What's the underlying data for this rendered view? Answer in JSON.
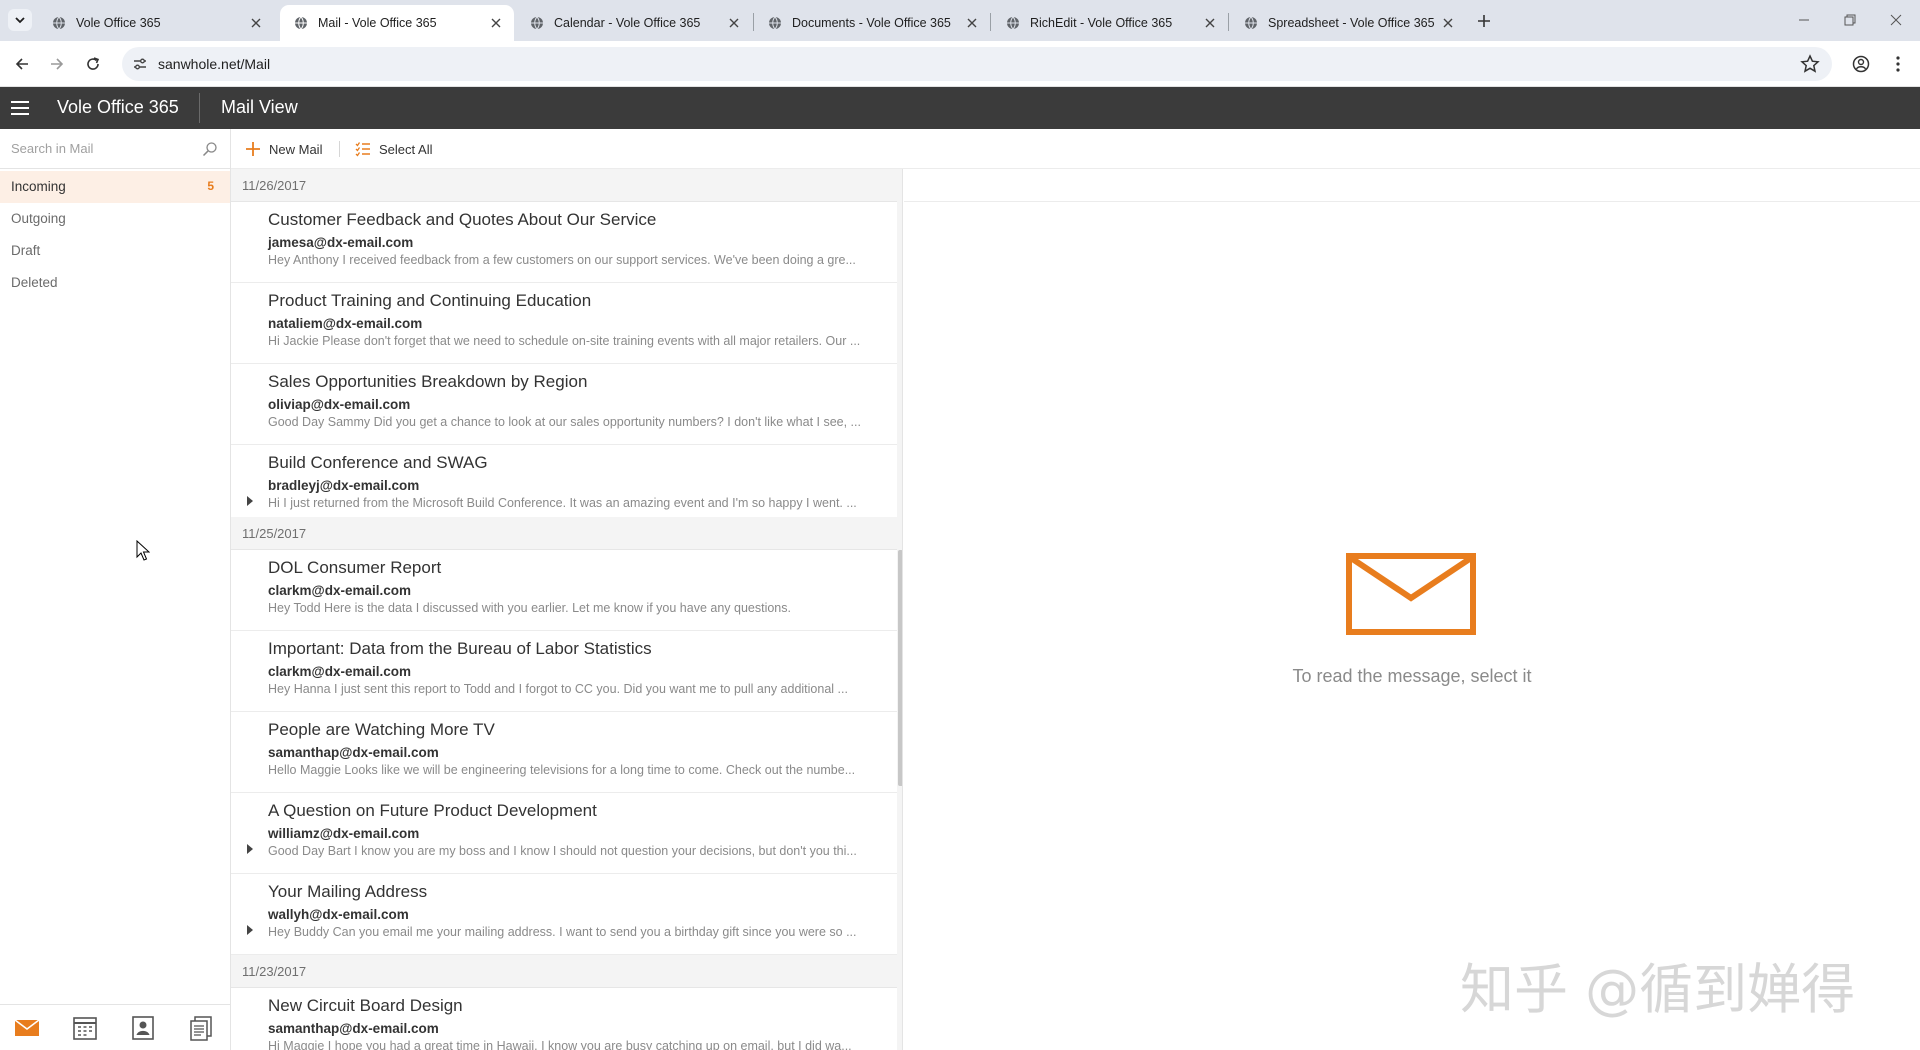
{
  "browser": {
    "tabs": [
      {
        "label": "Vole Office 365",
        "active": false
      },
      {
        "label": "Mail - Vole Office 365",
        "active": true
      },
      {
        "label": "Calendar - Vole Office 365",
        "active": false
      },
      {
        "label": "Documents - Vole Office 365",
        "active": false
      },
      {
        "label": "RichEdit - Vole Office 365",
        "active": false
      },
      {
        "label": "Spreadsheet - Vole Office 365",
        "active": false
      }
    ],
    "url": "sanwhole.net/Mail"
  },
  "app": {
    "title": "Vole Office 365",
    "view_title": "Mail View",
    "accent_color": "#e87d1e"
  },
  "sidebar": {
    "search_placeholder": "Search in Mail",
    "folders": [
      {
        "label": "Incoming",
        "count": "5",
        "active": true
      },
      {
        "label": "Outgoing",
        "count": "",
        "active": false
      },
      {
        "label": "Draft",
        "count": "",
        "active": false
      },
      {
        "label": "Deleted",
        "count": "",
        "active": false
      }
    ],
    "bottom_icons": [
      "mail-icon",
      "calendar-icon",
      "contacts-icon",
      "documents-icon"
    ]
  },
  "commands": {
    "new_mail": "New Mail",
    "select_all": "Select All"
  },
  "mail_groups": [
    {
      "date": "11/26/2017",
      "mails": [
        {
          "subject": "Customer Feedback and Quotes About Our Service",
          "from": "jamesa@dx-email.com",
          "preview": "Hey Anthony   I received feedback from a few customers on our support services. We've been doing a gre...",
          "thread": false
        },
        {
          "subject": "Product Training and Continuing Education",
          "from": "nataliem@dx-email.com",
          "preview": "Hi Jackie   Please don't forget that we need to schedule on-site training events with all major retailers. Our ...",
          "thread": false
        },
        {
          "subject": "Sales Opportunities Breakdown by Region",
          "from": "oliviap@dx-email.com",
          "preview": "Good Day Sammy   Did you get a chance to look at our sales opportunity numbers? I don't like what I see, ...",
          "thread": false
        },
        {
          "subject": "Build Conference and SWAG",
          "from": "bradleyj@dx-email.com",
          "preview": "Hi   I just returned from the Microsoft Build Conference. It was an amazing event and I'm so happy I went. ...",
          "thread": true
        }
      ]
    },
    {
      "date": "11/25/2017",
      "mails": [
        {
          "subject": "DOL Consumer Report",
          "from": "clarkm@dx-email.com",
          "preview": "Hey Todd   Here is the data I discussed with you earlier.  Let me know if you have any questions.",
          "thread": false
        },
        {
          "subject": "Important: Data from the Bureau of Labor Statistics",
          "from": "clarkm@dx-email.com",
          "preview": "Hey Hanna   I just sent this report to Todd and I forgot to CC you. Did you want me to pull any additional ...",
          "thread": false
        },
        {
          "subject": "People are Watching More TV",
          "from": "samanthap@dx-email.com",
          "preview": "Hello Maggie   Looks like we will be engineering televisions for a long time to come. Check out the numbe...",
          "thread": false
        },
        {
          "subject": "A Question on Future Product Development",
          "from": "williamz@dx-email.com",
          "preview": "Good Day Bart   I know you are my boss and I know I should not question your decisions, but don't you thi...",
          "thread": true
        },
        {
          "subject": "Your Mailing Address",
          "from": "wallyh@dx-email.com",
          "preview": "Hey Buddy   Can you email me your mailing address. I want to send you a birthday gift since you were so ...",
          "thread": true
        }
      ]
    },
    {
      "date": "11/23/2017",
      "mails": [
        {
          "subject": "New Circuit Board Design",
          "from": "samanthap@dx-email.com",
          "preview": "Hi Maggie   I hope you had a great time in Hawaii. I know you are busy catching up on email, but I did wa...",
          "thread": false
        }
      ]
    }
  ],
  "reading_pane": {
    "empty_message": "To read the message, select it"
  },
  "watermark": "知乎 @循到婵得"
}
